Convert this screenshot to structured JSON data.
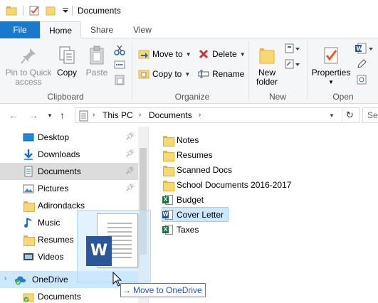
{
  "window": {
    "title": "Documents"
  },
  "tabs": [
    {
      "id": "file",
      "label": "File"
    },
    {
      "id": "home",
      "label": "Home"
    },
    {
      "id": "share",
      "label": "Share"
    },
    {
      "id": "view",
      "label": "View"
    }
  ],
  "ribbon": {
    "clipboard": {
      "group_label": "Clipboard",
      "pin_label_1": "Pin to Quick",
      "pin_label_2": "access",
      "copy_label": "Copy",
      "paste_label": "Paste"
    },
    "organize": {
      "group_label": "Organize",
      "move_to": "Move to",
      "copy_to": "Copy to",
      "delete": "Delete",
      "rename": "Rename"
    },
    "new": {
      "group_label": "New",
      "new_folder_1": "New",
      "new_folder_2": "folder"
    },
    "open": {
      "group_label": "Open",
      "properties": "Properties"
    }
  },
  "address": {
    "crumbs": [
      "This PC",
      "Documents"
    ],
    "search_placeholder": "Se"
  },
  "nav_pane": {
    "items": [
      {
        "label": "Desktop",
        "icon": "desktop-icon",
        "pinned": true
      },
      {
        "label": "Downloads",
        "icon": "downloads-icon",
        "pinned": true
      },
      {
        "label": "Documents",
        "icon": "documents-icon",
        "pinned": true,
        "selected": true
      },
      {
        "label": "Pictures",
        "icon": "pictures-icon",
        "pinned": true
      },
      {
        "label": "Adirondacks",
        "icon": "folder-icon",
        "pinned": false
      },
      {
        "label": "Music",
        "icon": "music-icon",
        "pinned": false
      },
      {
        "label": "Resumes",
        "icon": "folder-icon",
        "pinned": false
      },
      {
        "label": "Videos",
        "icon": "videos-icon",
        "pinned": false
      },
      {
        "label": "OneDrive",
        "icon": "onedrive-icon",
        "pinned": false
      },
      {
        "label": "Documents",
        "icon": "folder-icon",
        "pinned": false
      }
    ]
  },
  "files": [
    {
      "name": "Notes",
      "type": "folder"
    },
    {
      "name": "Resumes",
      "type": "folder"
    },
    {
      "name": "Scanned Docs",
      "type": "folder"
    },
    {
      "name": "School Documents 2016-2017",
      "type": "folder"
    },
    {
      "name": "Budget",
      "type": "excel"
    },
    {
      "name": "Cover Letter",
      "type": "word",
      "selected": true
    },
    {
      "name": "Taxes",
      "type": "excel"
    }
  ],
  "drag": {
    "tooltip": "Move to OneDrive",
    "ghost_badge": "W"
  },
  "colors": {
    "accent": "#1979ca",
    "selection": "#cce8ff",
    "folder": "#f8d775",
    "excel": "#1e7145",
    "word": "#2b579a"
  }
}
